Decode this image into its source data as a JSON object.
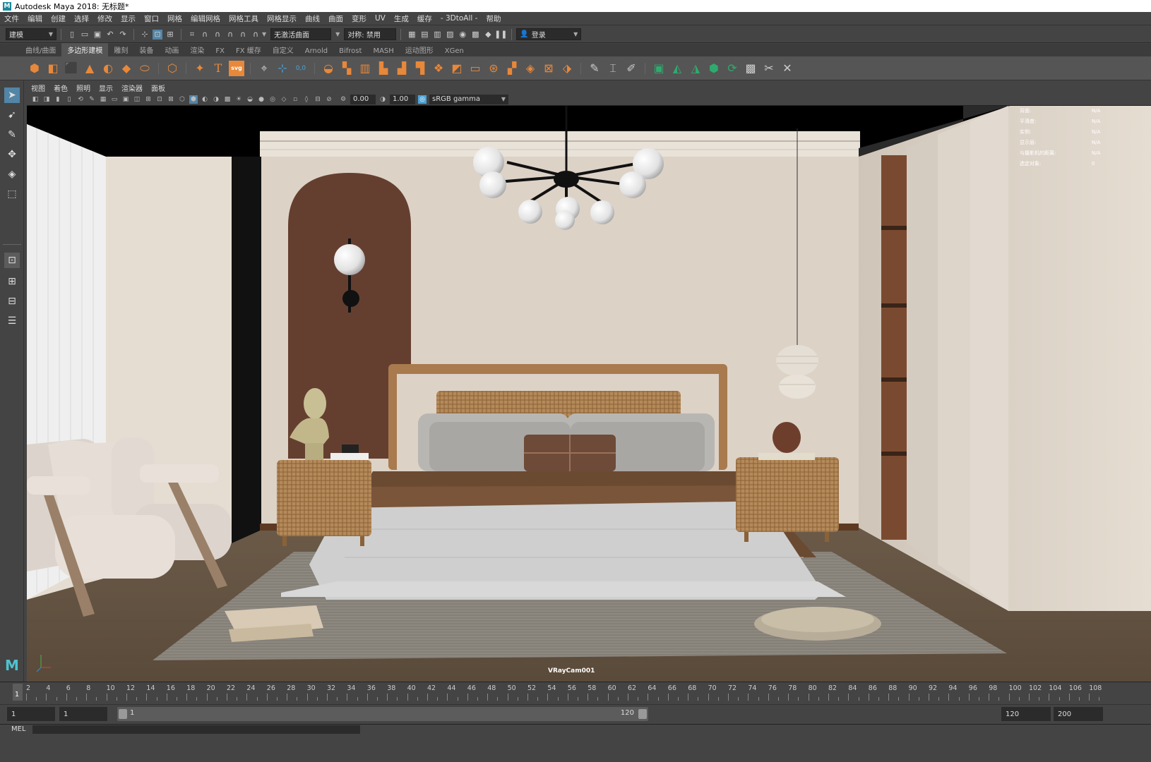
{
  "window": {
    "title": "Autodesk Maya 2018: 无标题*"
  },
  "menu": [
    "文件",
    "编辑",
    "创建",
    "选择",
    "修改",
    "显示",
    "窗口",
    "网格",
    "编辑网格",
    "网格工具",
    "网格显示",
    "曲线",
    "曲面",
    "变形",
    "UV",
    "生成",
    "缓存",
    "- 3DtoAll -",
    "帮助"
  ],
  "status": {
    "mode": "建模",
    "live_surface": "无激活曲面",
    "symmetry": "对称: 禁用",
    "login": "登录"
  },
  "shelf_tabs": [
    "曲线/曲面",
    "多边形建模",
    "雕刻",
    "装备",
    "动画",
    "渲染",
    "FX",
    "FX 缓存",
    "自定义",
    "Arnold",
    "Bifrost",
    "MASH",
    "运动图形",
    "XGen"
  ],
  "shelf_active": "多边形建模",
  "viewport": {
    "menu": [
      "视图",
      "着色",
      "照明",
      "显示",
      "渲染器",
      "面板"
    ],
    "exposure": "0.00",
    "gamma": "1.00",
    "color_space": "sRGB gamma",
    "camera": "VRayCam001",
    "hud": [
      {
        "label": "背面:",
        "value": "N/A"
      },
      {
        "label": "平滑度:",
        "value": "N/A"
      },
      {
        "label": "实例:",
        "value": "N/A"
      },
      {
        "label": "显示层:",
        "value": "N/A"
      },
      {
        "label": "与摄影机的距离:",
        "value": "N/A"
      },
      {
        "label": "选定对象:",
        "value": "0"
      }
    ]
  },
  "timeline": {
    "ticks": [
      "2",
      "4",
      "6",
      "8",
      "10",
      "12",
      "14",
      "16",
      "18",
      "20",
      "22",
      "24",
      "26",
      "28",
      "30",
      "32",
      "34",
      "36",
      "38",
      "40",
      "42",
      "44",
      "46",
      "48",
      "50",
      "52",
      "54",
      "56",
      "58",
      "60",
      "62",
      "64",
      "66",
      "68",
      "70",
      "72",
      "74",
      "76",
      "78",
      "80",
      "82",
      "84",
      "86",
      "88",
      "90",
      "92",
      "94",
      "96",
      "98",
      "100",
      "102",
      "104",
      "106",
      "108"
    ],
    "current": "1"
  },
  "range": {
    "start": "1",
    "playback_start": "1",
    "slider_start": "1",
    "slider_end": "120",
    "playback_end": "120",
    "end": "200"
  },
  "command_line": {
    "label": "MEL"
  },
  "colors": {
    "accent": "#5285a6",
    "ui_bg": "#444444",
    "shelf_orange": "#e8883a",
    "shelf_green": "#2faa6e"
  }
}
